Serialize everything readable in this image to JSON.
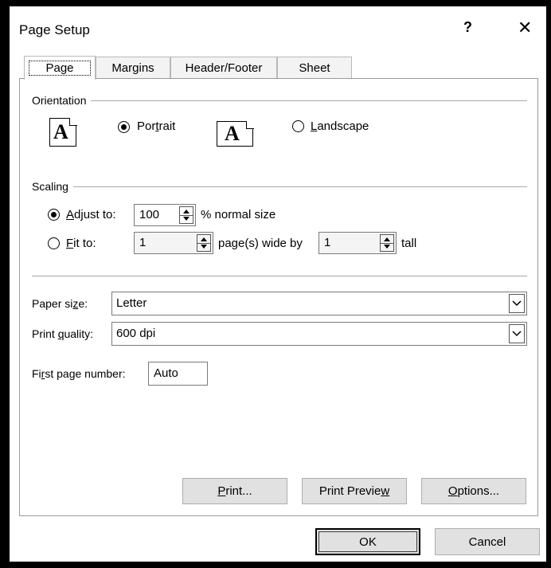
{
  "window": {
    "title": "Page Setup",
    "help": "?",
    "close": "✕"
  },
  "tabs": [
    {
      "label": "Page",
      "active": true
    },
    {
      "label": "Margins"
    },
    {
      "label": "Header/Footer"
    },
    {
      "label": "Sheet"
    }
  ],
  "orientation": {
    "group_label": "Orientation",
    "icon_letter": "A",
    "portrait": {
      "pre": "Por",
      "u": "t",
      "post": "rait",
      "selected": true
    },
    "landscape": {
      "pre": "",
      "u": "L",
      "post": "andscape",
      "selected": false
    }
  },
  "scaling": {
    "group_label": "Scaling",
    "adjust": {
      "pre": "",
      "u": "A",
      "post": "djust to:",
      "value": "100",
      "suffix": "% normal size",
      "selected": true
    },
    "fit": {
      "pre": "",
      "u": "F",
      "post": "it to:",
      "wide_value": "1",
      "wide_suffix": "page(s) wide by",
      "tall_value": "1",
      "tall_suffix": "tall",
      "selected": false
    }
  },
  "paper": {
    "size_label_pre": "Paper si",
    "size_label_u": "z",
    "size_label_post": "e:",
    "size_value": "Letter",
    "quality_label_pre": "Print ",
    "quality_label_u": "q",
    "quality_label_post": "uality:",
    "quality_value": "600 dpi",
    "first_label_pre": "Fi",
    "first_label_u": "r",
    "first_label_post": "st page number:",
    "first_value": "Auto"
  },
  "buttons": {
    "print": {
      "pre": "",
      "u": "P",
      "post": "rint..."
    },
    "preview": {
      "pre": "Print Previe",
      "u": "w",
      "post": ""
    },
    "options": {
      "pre": "",
      "u": "O",
      "post": "ptions..."
    },
    "ok": "OK",
    "cancel": "Cancel"
  }
}
